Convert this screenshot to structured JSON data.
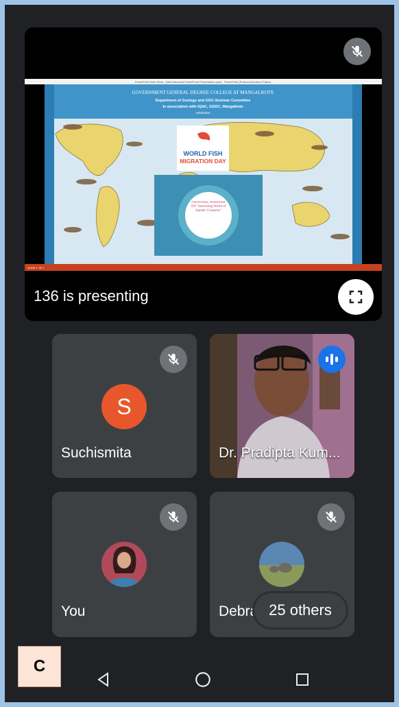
{
  "presentation": {
    "presenting_label": "136 is presenting",
    "slide": {
      "titlebar": "PowerPoint Slide Show - [New Microsoft PowerPoint Presentation.pptx] - PowerPoint (Product Activation Failed)",
      "heading": "GOVERNMENT GENERAL DEGREE COLLEGE AT MANGALKOTE",
      "line1": "Department of Zoology and UGC-Seminar Committee",
      "line2": "In association with IQAC, GGDC, Mangalkote",
      "line3": "celebrates",
      "logo_line1": "WORLD FISH",
      "logo_line2": "MIGRATION DAY",
      "poster_text": "NATIONAL WEBINAR ON \"Interesting World of Aquatic Creatures\"",
      "status_text": "SLIDE 1 OF 1"
    }
  },
  "participants": [
    {
      "name": "Suchismita",
      "avatar_letter": "S",
      "avatar_color": "#e8572b",
      "muted": true
    },
    {
      "name": "Dr. Pradipta Kum...",
      "speaking": true
    },
    {
      "name": "You",
      "muted": true
    },
    {
      "name": "Debraj",
      "muted": true
    }
  ],
  "others_label": "25 others",
  "corner_label": "C",
  "colors": {
    "background": "#202124",
    "tile": "#3c4043",
    "accent_blue": "#1a73e8"
  }
}
